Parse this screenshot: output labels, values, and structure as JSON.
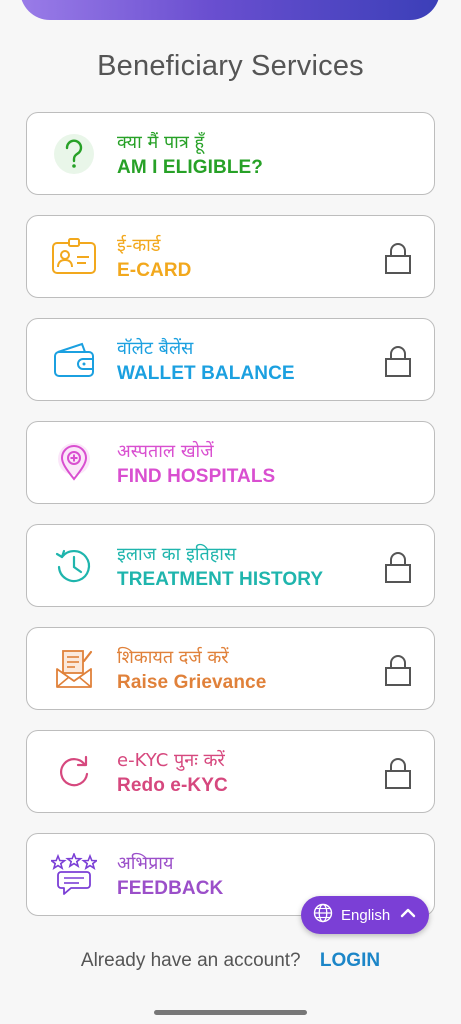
{
  "page": {
    "title": "Beneficiary Services"
  },
  "services": [
    {
      "hindi": "क्या मैं पात्र हूँ",
      "english": "AM I ELIGIBLE?",
      "color": "#27a127",
      "icon": "question-icon",
      "locked": false
    },
    {
      "hindi": "ई-कार्ड",
      "english": "E-CARD",
      "color": "#f2a81d",
      "icon": "id-card-icon",
      "locked": true
    },
    {
      "hindi": "वॉलेट बैलेंस",
      "english": "WALLET BALANCE",
      "color": "#1ba0e0",
      "icon": "wallet-icon",
      "locked": true
    },
    {
      "hindi": "अस्पताल खोजें",
      "english": "FIND HOSPITALS",
      "color": "#d94fd0",
      "icon": "hospital-location-icon",
      "locked": false
    },
    {
      "hindi": "इलाज का इतिहास",
      "english": "TREATMENT HISTORY",
      "color": "#1fb5ad",
      "icon": "history-icon",
      "locked": true
    },
    {
      "hindi": "शिकायत दर्ज करें",
      "english": "Raise Grievance",
      "color": "#e0813a",
      "icon": "grievance-letter-icon",
      "locked": true
    },
    {
      "hindi": "e-KYC पुनः करें",
      "english": "Redo e-KYC",
      "color": "#d6487e",
      "icon": "refresh-icon",
      "locked": true
    },
    {
      "hindi": "अभिप्राय",
      "english": "FEEDBACK",
      "color": "#9b4fc9",
      "icon": "feedback-icon",
      "locked": false
    }
  ],
  "language": {
    "label": "English",
    "color": "#7b3fd6"
  },
  "footer": {
    "prompt": "Already have an account?",
    "login_label": "LOGIN"
  }
}
